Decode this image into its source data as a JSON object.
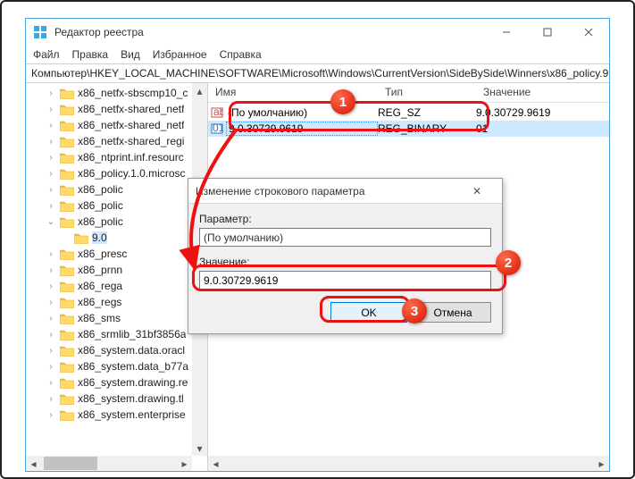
{
  "window": {
    "title": "Редактор реестра",
    "menus": [
      "Файл",
      "Правка",
      "Вид",
      "Избранное",
      "Справка"
    ],
    "path": "Компьютер\\HKEY_LOCAL_MACHINE\\SOFTWARE\\Microsoft\\Windows\\CurrentVersion\\SideBySide\\Winners\\x86_policy.9."
  },
  "tree": [
    {
      "label": "x86_netfx-sbscmp10_c",
      "tw": ">",
      "d": 0
    },
    {
      "label": "x86_netfx-shared_netf",
      "tw": ">",
      "d": 0
    },
    {
      "label": "x86_netfx-shared_netf",
      "tw": ">",
      "d": 0
    },
    {
      "label": "x86_netfx-shared_regi",
      "tw": ">",
      "d": 0
    },
    {
      "label": "x86_ntprint.inf.resourc",
      "tw": ">",
      "d": 0
    },
    {
      "label": "x86_policy.1.0.microsc",
      "tw": ">",
      "d": 0
    },
    {
      "label": "x86_polic",
      "tw": ">",
      "d": 0
    },
    {
      "label": "x86_polic",
      "tw": ">",
      "d": 0
    },
    {
      "label": "x86_polic",
      "tw": "v",
      "d": 0
    },
    {
      "label": "9.0",
      "tw": "",
      "d": 1,
      "sel": true
    },
    {
      "label": "x86_presc",
      "tw": ">",
      "d": 0
    },
    {
      "label": "x86_prnn",
      "tw": ">",
      "d": 0
    },
    {
      "label": "x86_rega",
      "tw": ">",
      "d": 0
    },
    {
      "label": "x86_regs",
      "tw": ">",
      "d": 0
    },
    {
      "label": "x86_sms",
      "tw": ">",
      "d": 0
    },
    {
      "label": "x86_srmlib_31bf3856a",
      "tw": ">",
      "d": 0
    },
    {
      "label": "x86_system.data.oracl",
      "tw": ">",
      "d": 0
    },
    {
      "label": "x86_system.data_b77a",
      "tw": ">",
      "d": 0
    },
    {
      "label": "x86_system.drawing.re",
      "tw": ">",
      "d": 0
    },
    {
      "label": "x86_system.drawing.tl",
      "tw": ">",
      "d": 0
    },
    {
      "label": "x86_system.enterprise",
      "tw": ">",
      "d": 0
    }
  ],
  "list": {
    "headers": {
      "name": "Имя",
      "type": "Тип",
      "value": "Значение"
    },
    "rows": [
      {
        "icon": "str",
        "name": "(По умолчанию)",
        "type": "REG_SZ",
        "value": "9.0.30729.9619"
      },
      {
        "icon": "bin",
        "name": "9.0.30729.9619",
        "type": "REG_BINARY",
        "value": "01",
        "sel": true
      }
    ]
  },
  "dialog": {
    "title": "Изменение строкового параметра",
    "param_label": "Параметр:",
    "param_value": "(По умолчанию)",
    "value_label": "Значение:",
    "value_value": "9.0.30729.9619",
    "ok": "OK",
    "cancel": "Отмена"
  },
  "callouts": {
    "n1": "1",
    "n2": "2",
    "n3": "3"
  }
}
